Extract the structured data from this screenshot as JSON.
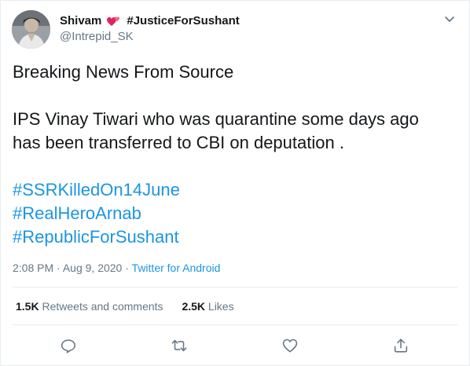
{
  "author": {
    "display_name": "Shivam",
    "display_name_suffix": "#JusticeForSushant",
    "handle": "@Intrepid_SK"
  },
  "tweet": {
    "line1": "Breaking News From Source",
    "line2": "IPS Vinay Tiwari who was quarantine some days ago",
    "line3": "has been transferred to CBI on deputation .",
    "hashtags": [
      "#SSRKilledOn14June",
      "#RealHeroArnab",
      "#RepublicForSushant"
    ]
  },
  "meta": {
    "time": "2:08 PM",
    "separator": "·",
    "date": "Aug 9, 2020",
    "source": "Twitter for Android"
  },
  "stats": {
    "retweets_count": "1.5K",
    "retweets_label": "Retweets and comments",
    "likes_count": "2.5K",
    "likes_label": "Likes"
  },
  "icons": {
    "heart_color": "#e0245e",
    "link_color": "#1b95e0",
    "actions": [
      "reply-icon",
      "retweet-icon",
      "like-icon",
      "share-icon"
    ]
  }
}
